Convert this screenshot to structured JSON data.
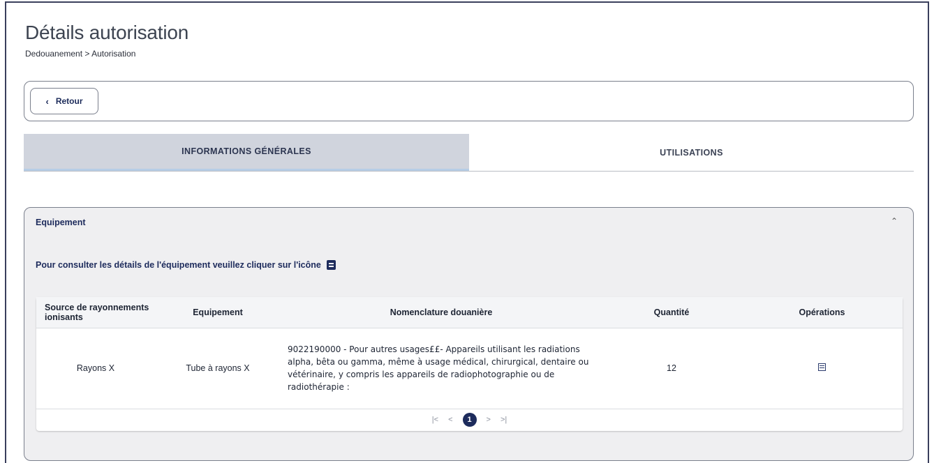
{
  "header": {
    "title": "Détails autorisation",
    "breadcrumb": "Dedouanement > Autorisation"
  },
  "toolbar": {
    "back_label": "Retour",
    "back_icon": "chevron-left-icon"
  },
  "tabs": [
    {
      "label": "INFORMATIONS GÉNÉRALES",
      "active": true
    },
    {
      "label": "UTILISATIONS",
      "active": false
    }
  ],
  "panel": {
    "title": "Equipement",
    "collapse_icon": "chevron-up-icon",
    "hint": "Pour consulter les détails de l'équipement veuillez cliquer sur l'icône"
  },
  "table": {
    "columns": [
      "Source de rayonnements ionisants",
      "Equipement",
      "Nomenclature douanière",
      "Quantité",
      "Opérations"
    ],
    "rows": [
      {
        "source": "Rayons X",
        "equipement": "Tube à rayons X",
        "nomenclature": "9022190000 - Pour autres usages££- Appareils utilisant les radiations alpha, bêta ou gamma, même à usage médical, chirurgical, dentaire ou vétérinaire, y compris les appareils de radiophotographie ou de radiothérapie :",
        "quantite": "12",
        "operation_icon": "details-icon"
      }
    ]
  },
  "pagination": {
    "first": "|<",
    "prev": "<",
    "current": "1",
    "next": ">",
    "last": ">|"
  }
}
